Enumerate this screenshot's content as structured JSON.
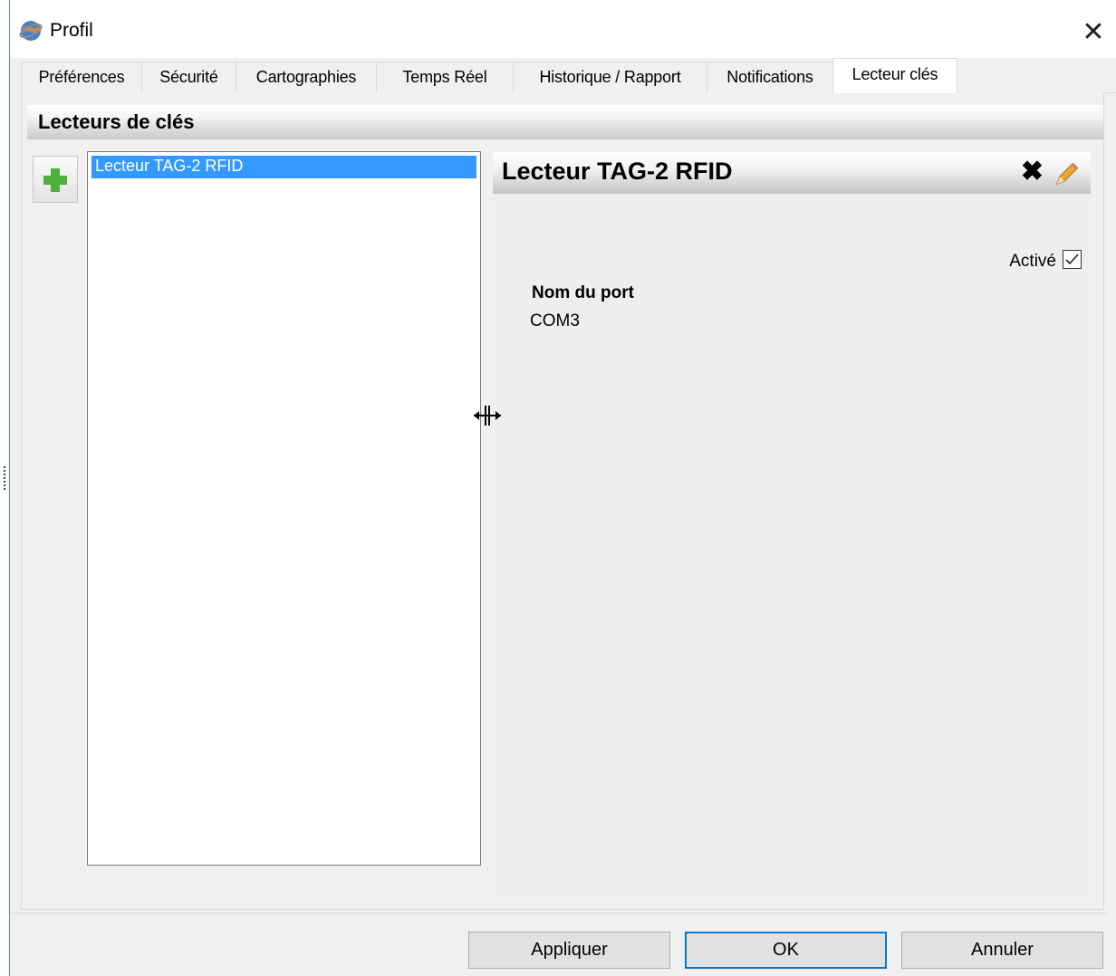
{
  "window": {
    "title": "Profil",
    "close_label": "✕"
  },
  "tabs": [
    {
      "label": "Préférences",
      "active": false
    },
    {
      "label": "Sécurité",
      "active": false
    },
    {
      "label": "Cartographies",
      "active": false
    },
    {
      "label": "Temps Réel",
      "active": false
    },
    {
      "label": "Historique / Rapport",
      "active": false
    },
    {
      "label": "Notifications",
      "active": false
    },
    {
      "label": "Lecteur clés",
      "active": true
    }
  ],
  "section": {
    "title": "Lecteurs de clés"
  },
  "list": {
    "items": [
      {
        "label": "Lecteur TAG-2 RFID",
        "selected": true
      }
    ]
  },
  "detail": {
    "title": "Lecteur TAG-2 RFID",
    "delete_glyph": "✖",
    "active_label": "Activé",
    "active_checked": true,
    "port_label": "Nom du port",
    "port_value": "COM3"
  },
  "buttons": {
    "apply": "Appliquer",
    "ok": "OK",
    "cancel": "Annuler"
  },
  "colors": {
    "selection": "#3399ff",
    "accent": "#0078d7",
    "add_icon": "#4caf3a",
    "pencil": "#f0a830"
  },
  "icons": {
    "app": "globe-icon",
    "close": "close-icon",
    "add": "plus-icon",
    "delete": "delete-icon",
    "edit": "pencil-icon",
    "cursor": "resize-cursor-icon"
  }
}
